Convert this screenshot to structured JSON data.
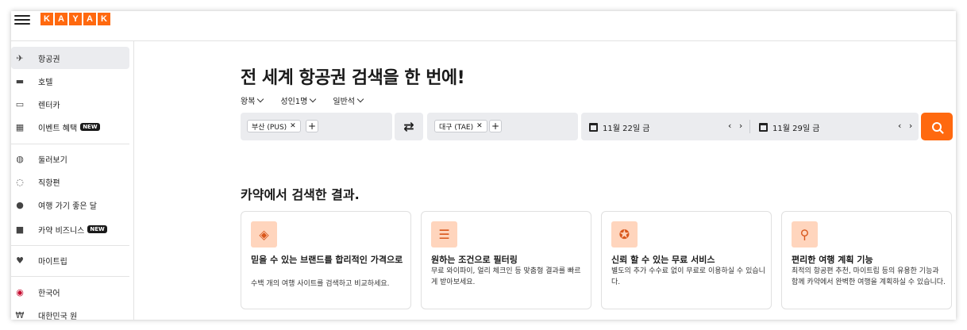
{
  "header": {
    "logo_letters": [
      "K",
      "A",
      "Y",
      "A",
      "K"
    ],
    "brand_color": "#ff690f"
  },
  "sidebar": {
    "items": [
      {
        "label": "항공권",
        "icon": "plane-icon"
      },
      {
        "label": "호텔",
        "icon": "bed-icon"
      },
      {
        "label": "렌터카",
        "icon": "car-icon"
      },
      {
        "label": "이벤트 혜택",
        "icon": "calendar-icon",
        "badge": "NEW"
      },
      {
        "label": "둘러보기",
        "icon": "globe-icon"
      },
      {
        "label": "직항편",
        "icon": "direct-flight-icon"
      },
      {
        "label": "여행 가기 좋은 달",
        "icon": "clock-icon"
      },
      {
        "label": "카약 비즈니스",
        "icon": "briefcase-icon",
        "badge": "NEW"
      },
      {
        "label": "마이트립",
        "icon": "heart-icon"
      },
      {
        "label": "한국어",
        "icon": "korea-flag-icon"
      },
      {
        "label": "대한민국 원",
        "icon": "currency-icon"
      }
    ]
  },
  "main": {
    "title": "전 세계 항공권 검색을 한 번에!",
    "options": {
      "trip_type": "왕복",
      "travelers": "성인1명",
      "cabin": "일반석"
    },
    "search": {
      "origin": "부산 (PUS)",
      "destination": "대구 (TAE)",
      "depart_date": "11월 22일 금",
      "return_date": "11월 29일 금",
      "date_arrows": "‹ ›"
    },
    "section_title": "카약에서 검색한 결과.",
    "cards": [
      {
        "title": "믿을 수 있는 브랜드를 합리적인 가격으로",
        "desc": "수백 개의 여행 사이트를 검색하고 비교하세요.",
        "icon": "price-tag-icon"
      },
      {
        "title": "원하는 조건으로 필터링",
        "desc": "무료 와이파이, 얼리 체크인 등 맞춤형 결과를 빠르게 받아보세요.",
        "icon": "sliders-icon"
      },
      {
        "title": "신뢰 할 수 있는 무료 서비스",
        "desc": "별도의 추가 수수료 없이 무료로 이용하실 수 있습니다.",
        "icon": "award-icon"
      },
      {
        "title": "편리한 여행 계획 기능",
        "desc": "최적의 항공편 추천, 마이트립 등의 유용한 기능과 함께 카약에서 완벽한 여행을 계획하실 수 있습니다.",
        "icon": "map-pin-icon"
      }
    ]
  }
}
